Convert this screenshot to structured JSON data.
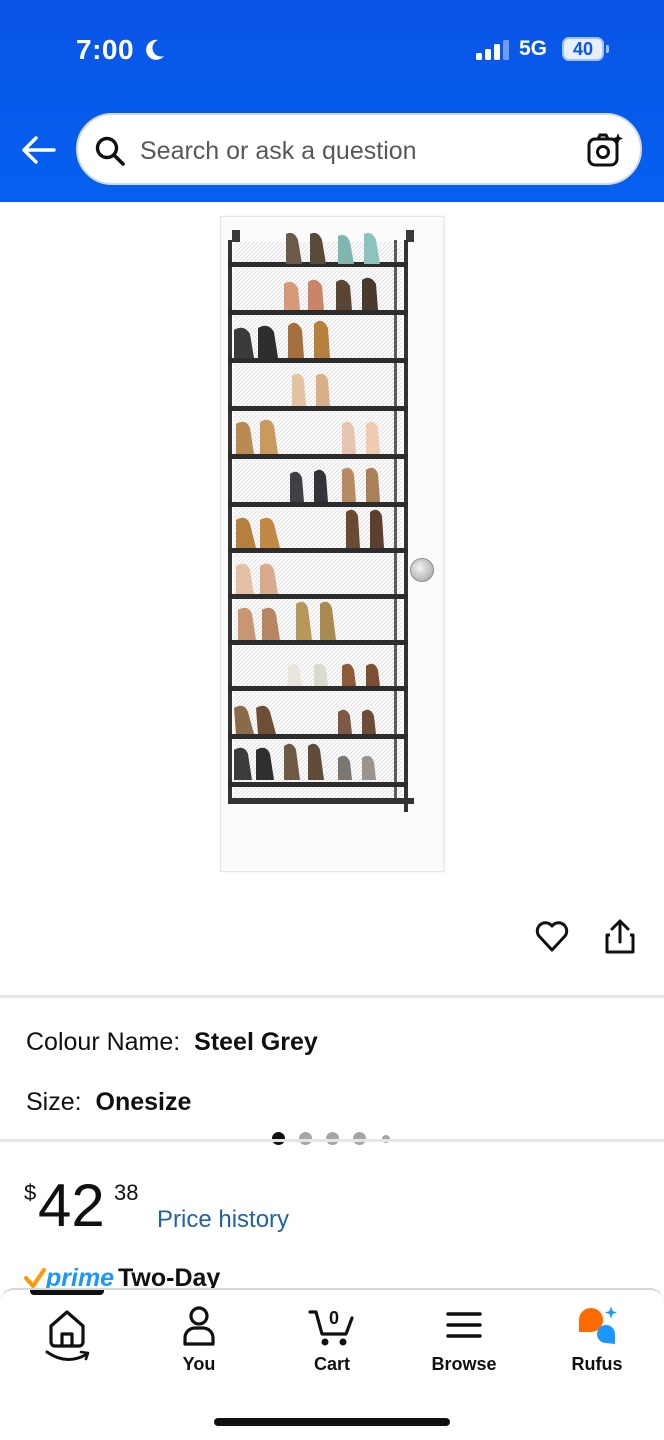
{
  "status_bar": {
    "time": "7:00",
    "network": "5G",
    "battery": "40"
  },
  "search": {
    "placeholder": "Search or ask a question"
  },
  "icons": {
    "back": "back-arrow-icon",
    "search": "search-icon",
    "camera": "camera-icon",
    "wishlist": "heart-icon",
    "share": "share-icon"
  },
  "gallery": {
    "image_count": 5,
    "active_index": 0
  },
  "variation": {
    "colour_label": "Colour Name:",
    "colour_value": "Steel Grey",
    "size_label": "Size:",
    "size_value": "Onesize"
  },
  "price": {
    "currency": "$",
    "whole": "42",
    "fraction": "38",
    "history_link": "Price history"
  },
  "delivery": {
    "prime": "prime",
    "speed": "Two-Day"
  },
  "bottom_nav": {
    "items": [
      {
        "label": "",
        "icon": "home-icon"
      },
      {
        "label": "You",
        "icon": "person-icon"
      },
      {
        "label": "Cart",
        "icon": "cart-icon",
        "count": "0"
      },
      {
        "label": "Browse",
        "icon": "menu-icon"
      },
      {
        "label": "Rufus",
        "icon": "rufus-icon"
      }
    ]
  },
  "colors": {
    "header_blue": "#0a55e6",
    "link_blue": "#2162a1",
    "rufus_orange": "#ff6a00",
    "rufus_blue": "#1a98ff"
  }
}
